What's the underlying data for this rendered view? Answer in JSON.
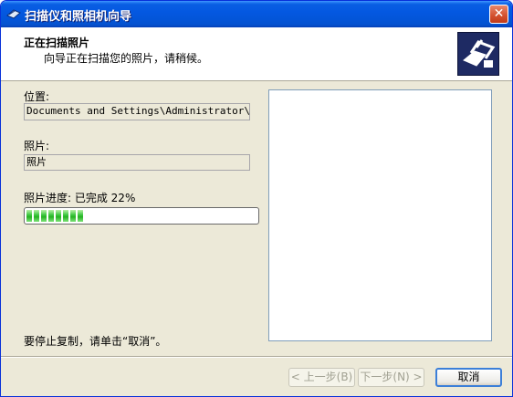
{
  "window": {
    "title": "扫描仪和照相机向导"
  },
  "header": {
    "title": "正在扫描照片",
    "subtitle": "向导正在扫描您的照片，请稍候。"
  },
  "location": {
    "label": "位置:",
    "value": "Documents and Settings\\Administrator\\桌面"
  },
  "photo": {
    "label": "照片:",
    "value": "照片"
  },
  "progress": {
    "label": "照片进度: 已完成 22%",
    "value_fraction": 0.22,
    "segments": 8
  },
  "hint": "要停止复制，请单击“取消”。",
  "buttons": {
    "back": "< 上一步(B)",
    "next": "下一步(N) >",
    "cancel": "取消"
  },
  "colors": {
    "titlebar": "#0458e1",
    "dialog_bg": "#ece9d8",
    "progress_fill": "#37c43a",
    "close": "#d3502d"
  }
}
